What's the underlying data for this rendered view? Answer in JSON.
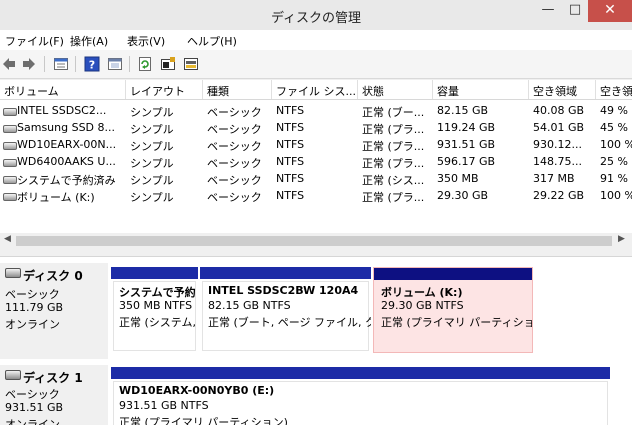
{
  "window": {
    "title": "ディスクの管理",
    "minimize": "—",
    "maximize": "□",
    "close": "✕"
  },
  "menu": [
    "ファイル(F)",
    "操作(A)",
    "表示(V)",
    "ヘルプ(H)"
  ],
  "toolbar_icons": [
    "back-arrow-icon",
    "forward-arrow-icon",
    "list-view-icon",
    "help-icon",
    "properties-icon",
    "refresh-icon",
    "settings-icon",
    "disk-props-icon"
  ],
  "volume_list": {
    "columns": [
      "ボリューム",
      "レイアウト",
      "種類",
      "ファイル シス...",
      "状態",
      "容量",
      "空き領域",
      "空き領"
    ],
    "rows": [
      [
        "INTEL SSDSC2...",
        "シンプル",
        "ベーシック",
        "NTFS",
        "正常 (ブー...",
        "82.15 GB",
        "40.08 GB",
        "49 %"
      ],
      [
        "Samsung SSD 8...",
        "シンプル",
        "ベーシック",
        "NTFS",
        "正常 (プラ...",
        "119.24 GB",
        "54.01 GB",
        "45 %"
      ],
      [
        "WD10EARX-00N...",
        "シンプル",
        "ベーシック",
        "NTFS",
        "正常 (プラ...",
        "931.51 GB",
        "930.12...",
        "100 %"
      ],
      [
        "WD6400AAKS U...",
        "シンプル",
        "ベーシック",
        "NTFS",
        "正常 (プラ...",
        "596.17 GB",
        "148.75...",
        "25 %"
      ],
      [
        "システムで予約済み",
        "シンプル",
        "ベーシック",
        "NTFS",
        "正常 (シス...",
        "350 MB",
        "317 MB",
        "91 %"
      ],
      [
        "ボリューム (K:)",
        "シンプル",
        "ベーシック",
        "NTFS",
        "正常 (プラ...",
        "29.30 GB",
        "29.22 GB",
        "100 %"
      ]
    ]
  },
  "colors": {
    "primary_bar": "#1c2ba6",
    "system_bar": "#0d1082",
    "selected_fill": "#fde4e4",
    "selected_border": "#f3b8b8"
  },
  "disks": [
    {
      "name": "ディスク 0",
      "type": "ベーシック",
      "size": "111.79 GB",
      "status": "オンライン",
      "partitions": [
        {
          "title": "システムで予約",
          "size": "350 MB NTFS",
          "status": "正常 (システム,"
        },
        {
          "title": "INTEL SSDSC2BW 120A4",
          "size": "82.15 GB NTFS",
          "status": "正常 (ブート, ページ ファイル, ク"
        },
        {
          "title": "ボリューム (K:)",
          "size": "29.30 GB NTFS",
          "status": "正常 (プライマリ パーティション)"
        }
      ]
    },
    {
      "name": "ディスク 1",
      "type": "ベーシック",
      "size": "931.51 GB",
      "status": "オンライン",
      "partitions": [
        {
          "title": "WD10EARX-00N0YB0 (E:)",
          "size": "931.51 GB NTFS",
          "status": "正常 (プライマリ パーティション)"
        }
      ]
    }
  ]
}
